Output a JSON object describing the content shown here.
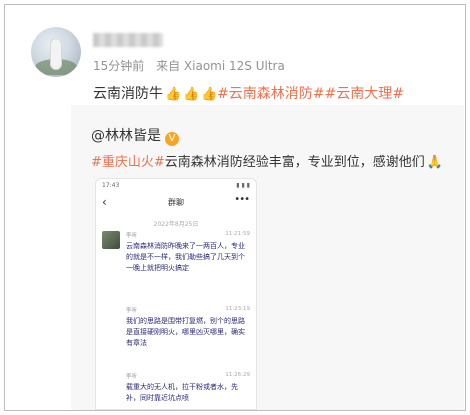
{
  "post": {
    "time": "15分钟前",
    "source": "来自 Xiaomi 12S Ultra",
    "text": "云南消防牛",
    "emojis": [
      "👍",
      "👍",
      "👍"
    ],
    "tags": [
      "#云南森林消防#",
      "#云南大理#"
    ]
  },
  "repost": {
    "user": "@林林皆是",
    "verified_badge": "V",
    "tag": "#重庆山火#",
    "text": "云南森林消防经验丰富，专业到位，感谢他们",
    "emoji": "🙏",
    "screenshot": {
      "status_time": "17:43",
      "status_right": "▮ ▮ ▮",
      "title": "群聊",
      "more": "•••",
      "back": "‹",
      "date": "2022年8月25日",
      "messages": [
        {
          "sender": "李听",
          "time": "11:21:59",
          "text": "云南森林消防昨晚来了一两百人，专业的就是不一样，我们勒些搞了几天到个一晚上就把明火搞定"
        },
        {
          "sender": "李听",
          "time": "11:23:19",
          "text": "我们的思路是围带打复燃，别个的思路是直接硬刚明火，哪里凶灭哪里，确实有章法"
        },
        {
          "sender": "李听",
          "time": "11:26:29",
          "text": "载重大的无人机，拉干粉或者水，先补，同时靠近坑点喷"
        }
      ]
    }
  },
  "colors": {
    "tag": "#eb7350",
    "badge": "#f5a623",
    "meta": "#939393"
  }
}
